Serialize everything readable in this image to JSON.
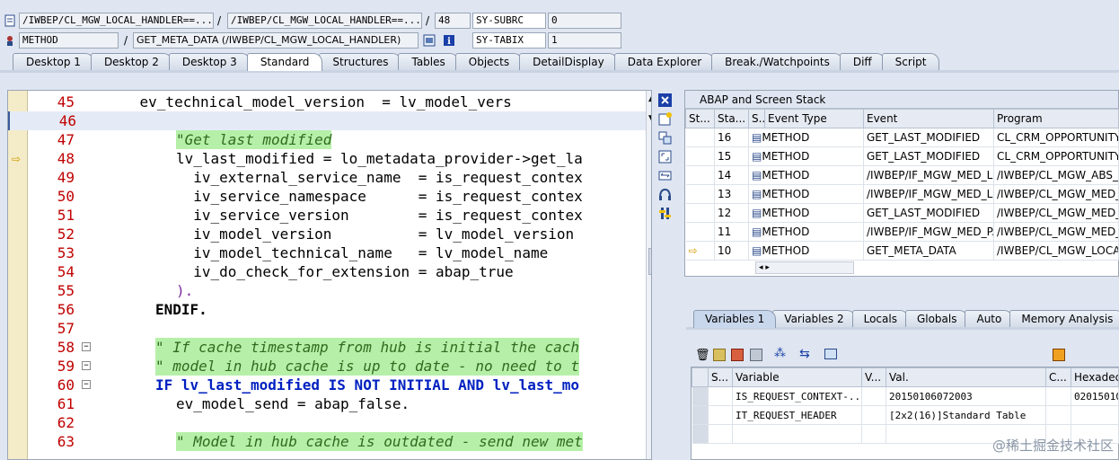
{
  "top": {
    "row1": {
      "program_field": "/IWBEP/CL_MGW_LOCAL_HANDLER==...",
      "include_field": "/IWBEP/CL_MGW_LOCAL_HANDLER==...",
      "line_number": "48",
      "sysvar1_name": "SY-SUBRC",
      "sysvar1_value": "0"
    },
    "row2": {
      "event_type": "METHOD",
      "event_name": "GET_META_DATA (/IWBEP/CL_MGW_LOCAL_HANDLER)",
      "sysvar2_name": "SY-TABIX",
      "sysvar2_value": "1"
    },
    "slash": "/"
  },
  "tabs": [
    "Desktop 1",
    "Desktop 2",
    "Desktop 3",
    "Standard",
    "Structures",
    "Tables",
    "Objects",
    "DetailDisplay",
    "Data Explorer",
    "Break./Watchpoints",
    "Diff",
    "Script"
  ],
  "active_tab": "Standard",
  "code": {
    "lines": [
      {
        "num": "45",
        "text": "    ev_technical_model_version  = lv_model_vers"
      },
      {
        "num": "46",
        "text": ""
      },
      {
        "num": "47",
        "text": "\"Get last modified"
      },
      {
        "num": "48",
        "text": "lv_last_modified = lo_metadata_provider->get_la"
      },
      {
        "num": "49",
        "text": "  iv_external_service_name  = is_request_contex"
      },
      {
        "num": "50",
        "text": "  iv_service_namespace      = is_request_contex"
      },
      {
        "num": "51",
        "text": "  iv_service_version        = is_request_contex"
      },
      {
        "num": "52",
        "text": "  iv_model_version          = lv_model_version"
      },
      {
        "num": "53",
        "text": "  iv_model_technical_name   = lv_model_name"
      },
      {
        "num": "54",
        "text": "  iv_do_check_for_extension = abap_true"
      },
      {
        "num": "55",
        "text": ")."
      },
      {
        "num": "56",
        "text": "ENDIF."
      },
      {
        "num": "57",
        "text": ""
      },
      {
        "num": "58",
        "text": "\" If cache timestamp from hub is initial the cach"
      },
      {
        "num": "59",
        "text": "\" model in hub cache is up to date - no need to t"
      },
      {
        "num": "60",
        "text": "IF lv_last_modified IS NOT INITIAL AND lv_last_mo"
      },
      {
        "num": "61",
        "text": "ev_model_send = abap_false."
      },
      {
        "num": "62",
        "text": ""
      },
      {
        "num": "63",
        "text": "\" Model in hub cache is outdated - send new met"
      }
    ]
  },
  "stack": {
    "title": "ABAP and Screen Stack",
    "columns": [
      "St...",
      "Sta...",
      "S...",
      "Event Type",
      "Event",
      "Program"
    ],
    "rows": [
      {
        "level": "16",
        "type": "METHOD",
        "event": "GET_LAST_MODIFIED",
        "program": "CL_CRM_OPPORTUNITY"
      },
      {
        "level": "15",
        "type": "METHOD",
        "event": "GET_LAST_MODIFIED",
        "program": "CL_CRM_OPPORTUNITY"
      },
      {
        "level": "14",
        "type": "METHOD",
        "event": "/IWBEP/IF_MGW_MED_L...",
        "program": "/IWBEP/CL_MGW_ABS_..."
      },
      {
        "level": "13",
        "type": "METHOD",
        "event": "/IWBEP/IF_MGW_MED_L...",
        "program": "/IWBEP/CL_MGW_MED_..."
      },
      {
        "level": "12",
        "type": "METHOD",
        "event": "GET_LAST_MODIFIED",
        "program": "/IWBEP/CL_MGW_MED_..."
      },
      {
        "level": "11",
        "type": "METHOD",
        "event": "/IWBEP/IF_MGW_MED_P...",
        "program": "/IWBEP/CL_MGW_MED_..."
      },
      {
        "level": "10",
        "type": "METHOD",
        "event": "GET_META_DATA",
        "program": "/IWBEP/CL_MGW_LOCA"
      }
    ]
  },
  "vartabs": [
    "Variables 1",
    "Variables 2",
    "Locals",
    "Globals",
    "Auto",
    "Memory Analysis"
  ],
  "variables": {
    "columns": [
      "S...",
      "Variable",
      "V...",
      "Val.",
      "C...",
      "Hexadeci"
    ],
    "rows": [
      {
        "variable": "IS_REQUEST_CONTEXT-...",
        "value": "20150106072003",
        "hex": "02015010"
      },
      {
        "variable": "IT_REQUEST_HEADER",
        "value": "[2x2(16)]Standard Table",
        "hex": ""
      }
    ]
  },
  "watermark": "@稀土掘金技术社区"
}
